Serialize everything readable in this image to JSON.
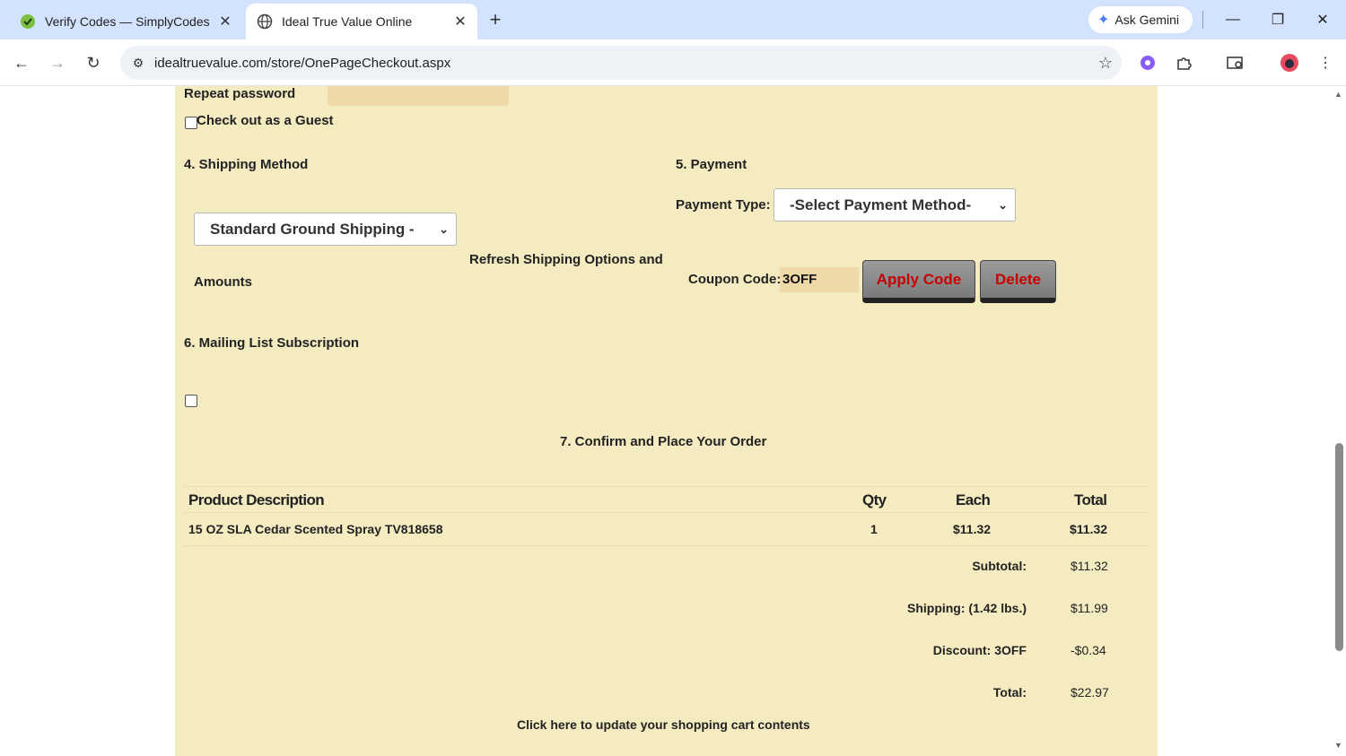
{
  "browser": {
    "tabs": [
      {
        "title": "Verify Codes — SimplyCodes",
        "active": false
      },
      {
        "title": "Ideal True Value Online",
        "active": true
      }
    ],
    "gemini_label": "Ask Gemini",
    "url": "idealtruevalue.com/store/OnePageCheckout.aspx"
  },
  "account": {
    "repeat_password_label": "Repeat password",
    "guest_label": "Check out as a Guest"
  },
  "shipping": {
    "heading": "4. Shipping Method",
    "selected_option": "Standard Ground Shipping -",
    "refresh_text_1": "Refresh Shipping Options and",
    "refresh_text_2": "Amounts"
  },
  "payment": {
    "heading": "5. Payment",
    "type_label": "Payment Type:",
    "selected_method": "-Select Payment Method-",
    "coupon_label": "Coupon Code:",
    "coupon_value": "3OFF",
    "apply_label": "Apply Code",
    "delete_label": "Delete"
  },
  "mailing": {
    "heading": "6. Mailing List Subscription"
  },
  "order": {
    "heading": "7. Confirm and Place Your Order",
    "columns": [
      "Product Description",
      "Qty",
      "Each",
      "Total"
    ],
    "items": [
      {
        "description": "15 OZ SLA Cedar Scented Spray TV818658",
        "qty": "1",
        "each": "$11.32",
        "total": "$11.32"
      }
    ],
    "summary": {
      "subtotal_label": "Subtotal:",
      "subtotal": "$11.32",
      "shipping_label": "Shipping: (1.42 lbs.)",
      "shipping": "$11.99",
      "discount_label": "Discount: 3OFF",
      "discount": "-$0.34",
      "total_label": "Total:",
      "total": "$22.97"
    },
    "update_cart_link": "Click here to update your shopping cart contents"
  }
}
